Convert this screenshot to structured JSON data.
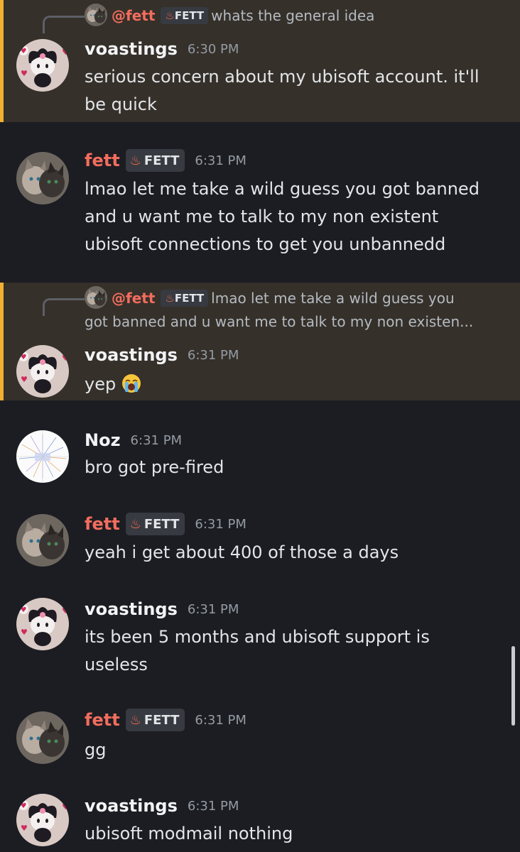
{
  "messages": [
    {
      "reply": {
        "mention": "@fett",
        "tag": "FETT",
        "text": "whats the general idea"
      },
      "user": "voastings",
      "time": "6:30 PM",
      "lines": [
        "serious concern about my ubisoft account. it'll",
        "be quick"
      ]
    },
    {
      "user": "fett",
      "tag": "FETT",
      "time": "6:31 PM",
      "lines": [
        "lmao let me take a wild guess you got banned",
        "and u want me to talk to my non existent",
        "ubisoft connections to get you unbannedd"
      ]
    },
    {
      "reply": {
        "mention": "@fett",
        "tag": "FETT",
        "text": "lmao let me take a wild guess you",
        "text2": "got banned and u want me to talk to my non existen..."
      },
      "user": "voastings",
      "time": "6:31 PM",
      "lines": [
        "yep"
      ],
      "emoji": "loudly-crying-face"
    },
    {
      "user": "Noz",
      "time": "6:31 PM",
      "lines": [
        "bro got pre-fired"
      ]
    },
    {
      "user": "fett",
      "tag": "FETT",
      "time": "6:31 PM",
      "lines": [
        "yeah i get about 400 of those a days"
      ]
    },
    {
      "user": "voastings",
      "time": "6:31 PM",
      "lines": [
        "its been 5 months and ubisoft support is",
        "useless"
      ]
    },
    {
      "user": "fett",
      "tag": "FETT",
      "time": "6:31 PM",
      "lines": [
        "gg"
      ]
    },
    {
      "user": "voastings",
      "time": "6:31 PM",
      "lines": [
        "ubisoft modmail nothing"
      ]
    }
  ],
  "colors": {
    "background": "#1c1d22",
    "highlight": "#35302a",
    "highlight_bar": "#f0b132",
    "fett_name": "#f26d5e",
    "timestamp": "#949ba4"
  }
}
